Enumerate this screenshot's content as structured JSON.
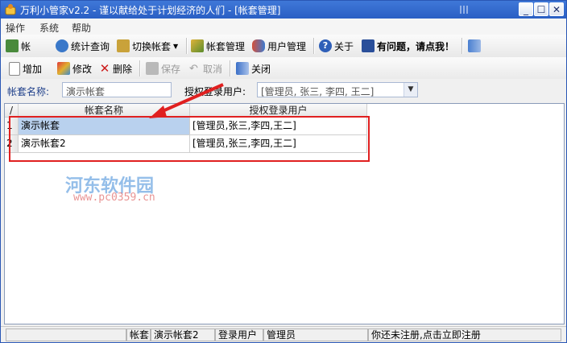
{
  "window": {
    "title": "万利小管家v2.2 - 谨以献给处于计划经济的人们 - [帐套管理]",
    "controls": [
      "_",
      "☐",
      "✕"
    ]
  },
  "menu": [
    "操作",
    "系统",
    "帮助"
  ],
  "toolbar_main": [
    {
      "label": "帐",
      "icon": "ledger-icon"
    },
    {
      "label": "统计查询",
      "icon": "query-icon"
    },
    {
      "label": "切换帐套",
      "icon": "switch-icon"
    },
    {
      "label": "帐套管理",
      "icon": "account-set-icon"
    },
    {
      "label": "用户管理",
      "icon": "users-icon"
    },
    {
      "label": "关于",
      "icon": "help-icon"
    },
    {
      "label": "有问题，请点我！",
      "icon": "book-icon"
    },
    {
      "label": "",
      "icon": "exit-icon"
    }
  ],
  "toolbar_edit": [
    {
      "label": "增加",
      "icon": "new-doc-icon",
      "enabled": true
    },
    {
      "label": "修改",
      "icon": "pen-icon",
      "enabled": true
    },
    {
      "label": "删除",
      "icon": "delete-x-icon",
      "enabled": true
    },
    {
      "label": "保存",
      "icon": "save-icon",
      "enabled": false
    },
    {
      "label": "取消",
      "icon": "undo-icon",
      "enabled": false
    },
    {
      "label": "关闭",
      "icon": "close-door-icon",
      "enabled": true
    }
  ],
  "filter": {
    "name_label": "帐套名称:",
    "name_value": "演示帐套",
    "user_label": "授权登录用户:",
    "user_value": "[管理员, 张三, 李四, 王二]"
  },
  "grid": {
    "corner": "/",
    "columns": [
      "帐套名称",
      "授权登录用户"
    ],
    "rows": [
      {
        "index": "1",
        "name": "演示帐套",
        "users": "[管理员,张三,李四,王二]"
      },
      {
        "index": "2",
        "name": "演示帐套2",
        "users": "[管理员,张三,李四,王二]"
      }
    ]
  },
  "statusbar": {
    "set_label": "帐套",
    "set_value": "演示帐套2",
    "user_label": "登录用户",
    "user_value": "管理员",
    "register": "你还未注册,点击立即注册"
  },
  "watermark": {
    "cn": "河东软件园",
    "url": "www.pc0359.cn"
  }
}
